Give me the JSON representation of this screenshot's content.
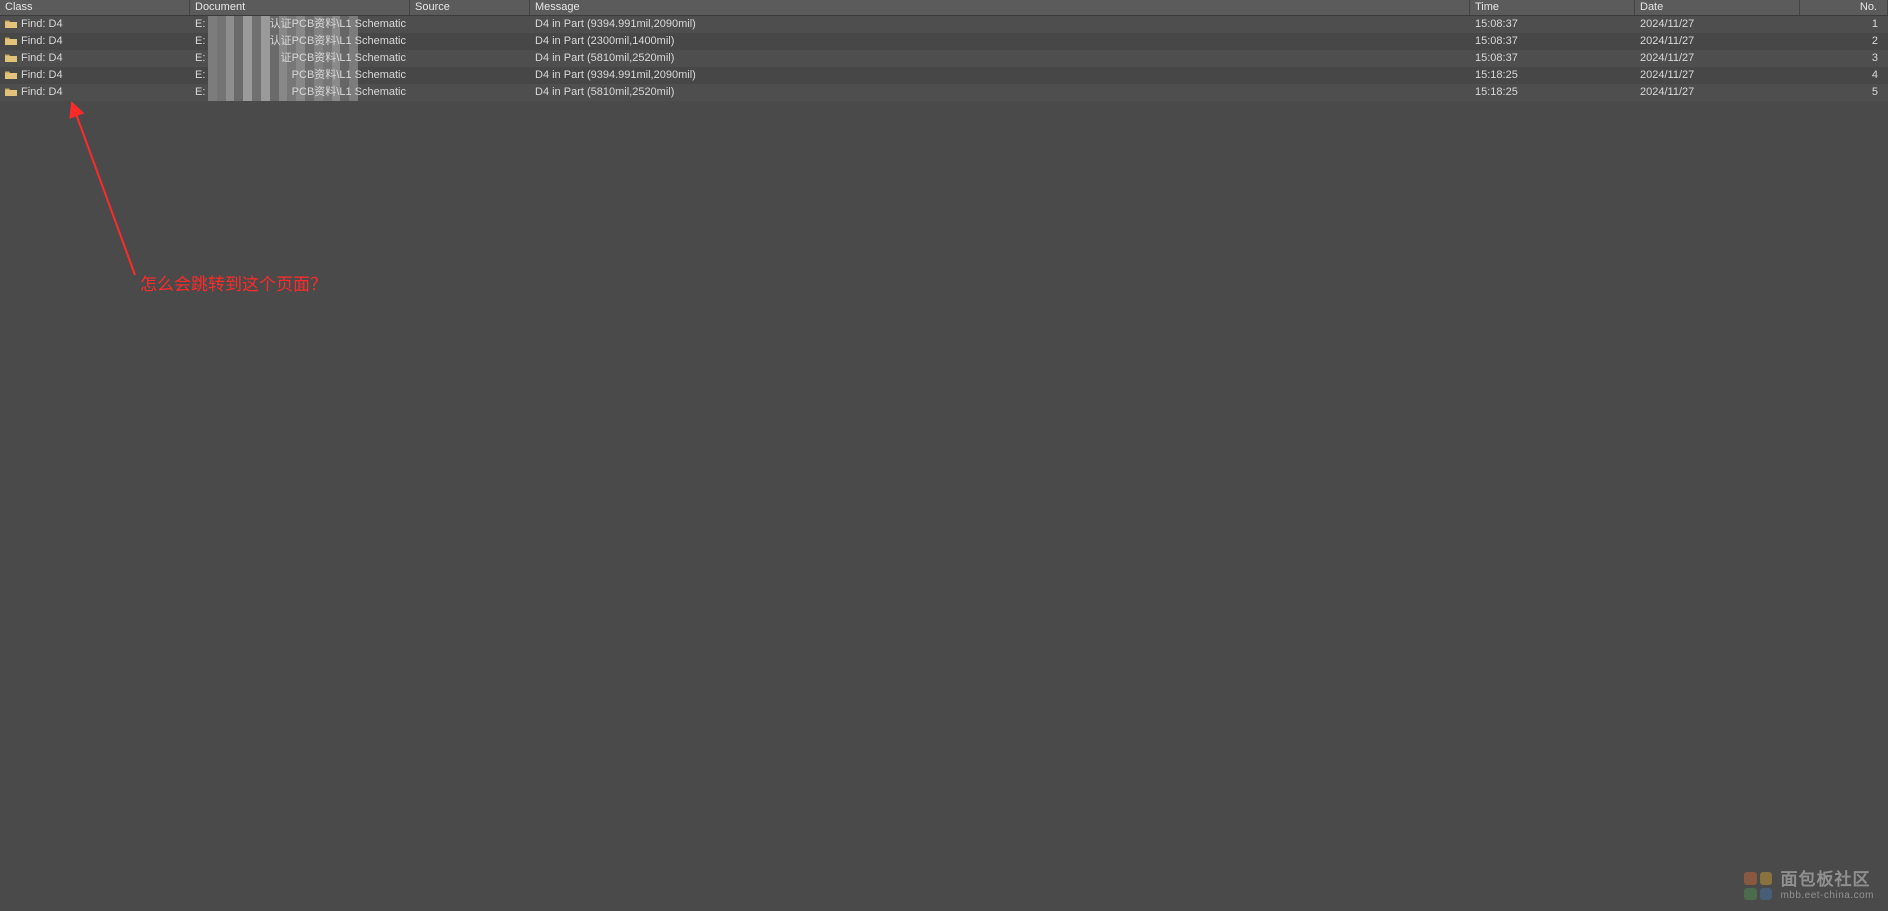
{
  "columns": {
    "class": "Class",
    "document": "Document",
    "source": "Source",
    "message": "Message",
    "time": "Time",
    "date": "Date",
    "no": "No."
  },
  "rows": [
    {
      "class": "Find: D4",
      "doc_prefix": "E:",
      "doc_suffix": "认证PCB资料\\L1 Schematic",
      "message": "D4 in Part (9394.991mil,2090mil)",
      "time": "15:08:37",
      "date": "2024/11/27",
      "no": "1"
    },
    {
      "class": "Find: D4",
      "doc_prefix": "E:",
      "doc_suffix": "认证PCB资料\\L1 Schematic",
      "message": "D4 in Part (2300mil,1400mil)",
      "time": "15:08:37",
      "date": "2024/11/27",
      "no": "2"
    },
    {
      "class": "Find: D4",
      "doc_prefix": "E:",
      "doc_suffix": "证PCB资料\\L1 Schematic",
      "message": "D4 in Part (5810mil,2520mil)",
      "time": "15:08:37",
      "date": "2024/11/27",
      "no": "3"
    },
    {
      "class": "Find: D4",
      "doc_prefix": "E:",
      "doc_suffix": "PCB资料\\L1 Schematic",
      "message": "D4 in Part (9394.991mil,2090mil)",
      "time": "15:18:25",
      "date": "2024/11/27",
      "no": "4"
    },
    {
      "class": "Find: D4",
      "doc_prefix": "E:",
      "doc_suffix": "PCB资料\\L1 Schematic",
      "message": "D4 in Part (5810mil,2520mil)",
      "time": "15:18:25",
      "date": "2024/11/27",
      "no": "5"
    }
  ],
  "annotation": "怎么会跳转到这个页面？",
  "watermark": {
    "title": "面包板社区",
    "sub": "mbb.eet-china.com"
  },
  "pixel_shades": [
    "#6a6a6a",
    "#8a8a8a",
    "#777",
    "#9a9a9a",
    "#666",
    "#888",
    "#707070",
    "#7c7c7c",
    "#6e6e6e",
    "#9a9a9a",
    "#747474",
    "#828282",
    "#6a6a6a",
    "#8e8e8e",
    "#767676",
    "#888"
  ]
}
